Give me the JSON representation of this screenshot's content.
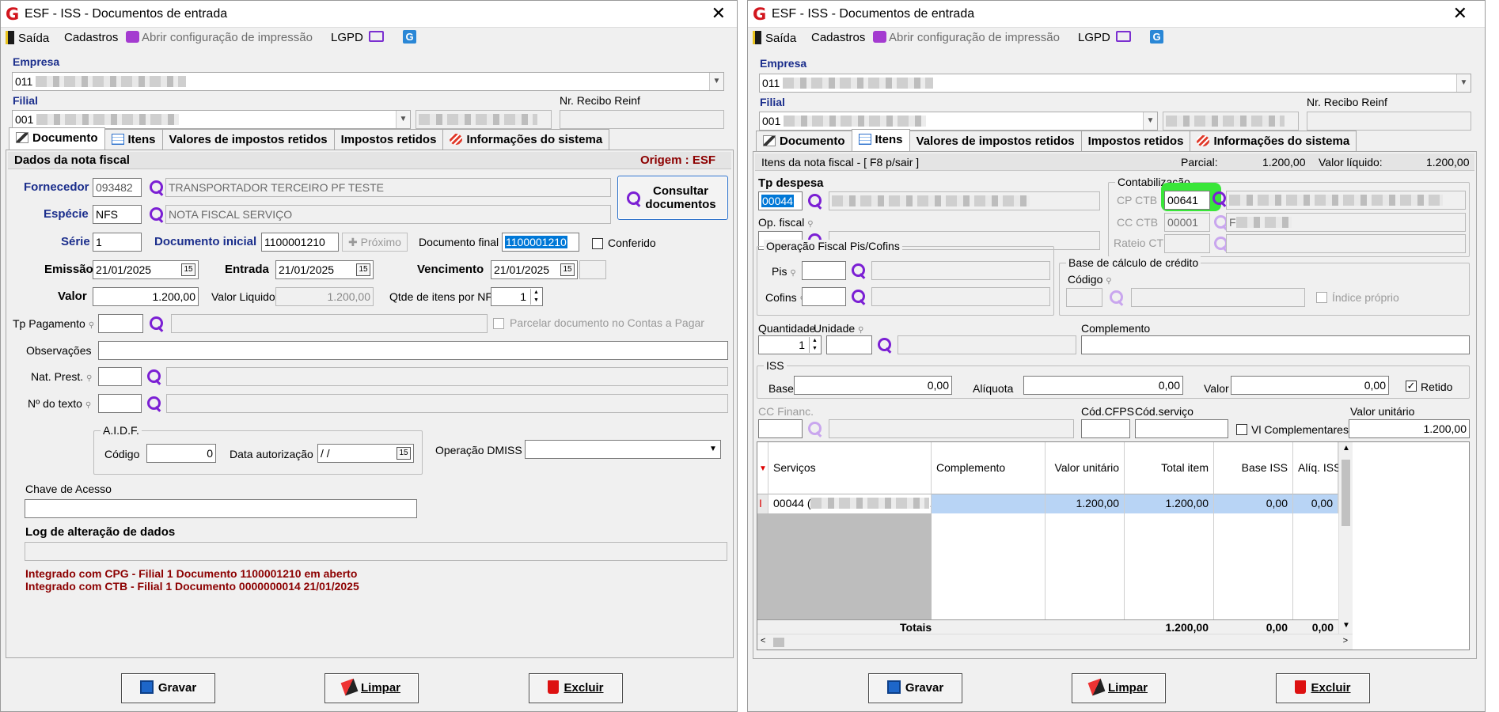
{
  "window_title": "ESF - ISS - Documentos de entrada",
  "menu": {
    "saida": "Saída",
    "cadastros": "Cadastros",
    "impressao": "Abrir configuração de impressão",
    "lgpd": "LGPD"
  },
  "empresa": {
    "label": "Empresa",
    "value": "011"
  },
  "filial": {
    "label": "Filial",
    "value": "001"
  },
  "nr_recibo_label": "Nr. Recibo Reinf",
  "tabs": [
    "Documento",
    "Itens",
    "Valores de impostos retidos",
    "Impostos retidos",
    "Informações do sistema"
  ],
  "doc": {
    "header": "Dados da nota fiscal",
    "origem": "Origem : ESF",
    "fornecedor_label": "Fornecedor",
    "fornecedor_code": "093482",
    "fornecedor_name": "TRANSPORTADOR TERCEIRO PF TESTE",
    "especie_label": "Espécie",
    "especie_code": "NFS",
    "especie_name": "NOTA FISCAL SERVIÇO",
    "consultar_label": "Consultar documentos",
    "serie_label": "Série",
    "serie": "1",
    "doc_inicial_label": "Documento inicial",
    "doc_inicial": "1100001210",
    "proximo_label": "Próximo",
    "doc_final_label": "Documento final",
    "doc_final": "1100001210",
    "conferido_label": "Conferido",
    "emissao_label": "Emissão",
    "emissao": "21/01/2025",
    "entrada_label": "Entrada",
    "entrada": "21/01/2025",
    "vencimento_label": "Vencimento",
    "vencimento": "21/01/2025",
    "valor_label": "Valor",
    "valor": "1.200,00",
    "valor_liquido_label": "Valor Liquido",
    "valor_liquido": "1.200,00",
    "qtde_label": "Qtde de itens por NF",
    "qtde": "1",
    "tp_pagamento_label": "Tp Pagamento",
    "parcelar_label": "Parcelar documento no Contas a Pagar",
    "observacoes_label": "Observações",
    "nat_prest_label": "Nat. Prest.",
    "no_texto_label": "Nº do texto",
    "aidf_label": "A.I.D.F.",
    "codigo_label": "Código",
    "codigo": "0",
    "data_aut_label": "Data autorização",
    "data_aut": " / /",
    "operacao_dmiss_label": "Operação DMISS",
    "chave_label": "Chave de Acesso",
    "log_label": "Log de alteração de dados",
    "log_lines": [
      "Integrado com CPG - Filial 1 Documento 1100001210 em aberto",
      "Integrado com CTB - Filial 1 Documento 0000000014 21/01/2025"
    ]
  },
  "itens": {
    "header": "Itens da nota fiscal - [ F8 p/sair ]",
    "parcial_label": "Parcial:",
    "parcial": "1.200,00",
    "liquido_label": "Valor líquido:",
    "liquido": "1.200,00",
    "tp_despesa_label": "Tp despesa",
    "tp_despesa": "00044",
    "op_fiscal_label": "Op. fiscal",
    "contabilizacao_label": "Contabilização",
    "cp_ctb_label": "CP CTB",
    "cp_ctb": "00641",
    "cc_ctb_label": "CC CTB",
    "cc_ctb": "00001",
    "cc_ctb_name": "F",
    "rateio_label": "Rateio CTB",
    "pis_cofins_label": "Operação Fiscal Pis/Cofins",
    "pis_label": "Pis",
    "cofins_label": "Cofins",
    "base_credito_label": "Base de cálculo de crédito",
    "codigo_label": "Código",
    "indice_label": "Índice próprio",
    "quantidade_label": "Quantidade",
    "quantidade": "1",
    "unidade_label": "Unidade",
    "complemento_label": "Complemento",
    "iss_label": "ISS",
    "base_label": "Base",
    "base": "0,00",
    "aliquota_label": "Alíquota",
    "aliquota": "0,00",
    "valor_label": "Valor",
    "valor": "0,00",
    "retido_label": "Retido",
    "cc_financ_label": "CC Financ.",
    "cod_cfps_label": "Cód.CFPS",
    "cod_servico_label": "Cód.serviço",
    "vl_compl_label": "Vl Complementares",
    "valor_unitario_label": "Valor unitário",
    "valor_unitario": "1.200,00",
    "grid": {
      "columns": [
        "Serviços",
        "Complemento",
        "Valor unitário",
        "Total item",
        "Base ISS",
        "Alíq. ISS"
      ],
      "rows": [
        {
          "servico": "00044 (",
          "complemento": "",
          "valor_unitario": "1.200,00",
          "total_item": "1.200,00",
          "base_iss": "0,00",
          "aliq_iss": "0,00"
        }
      ],
      "totais_label": "Totais",
      "total_item": "1.200,00",
      "base_iss": "0,00",
      "aliq_iss": "0,00"
    }
  },
  "buttons": {
    "gravar": "Gravar",
    "limpar": "Limpar",
    "excluir": "Excluir"
  },
  "colors": {
    "accent_green": "#39e639",
    "label_blue": "#1b2e8c",
    "log_red": "#8c0000"
  }
}
